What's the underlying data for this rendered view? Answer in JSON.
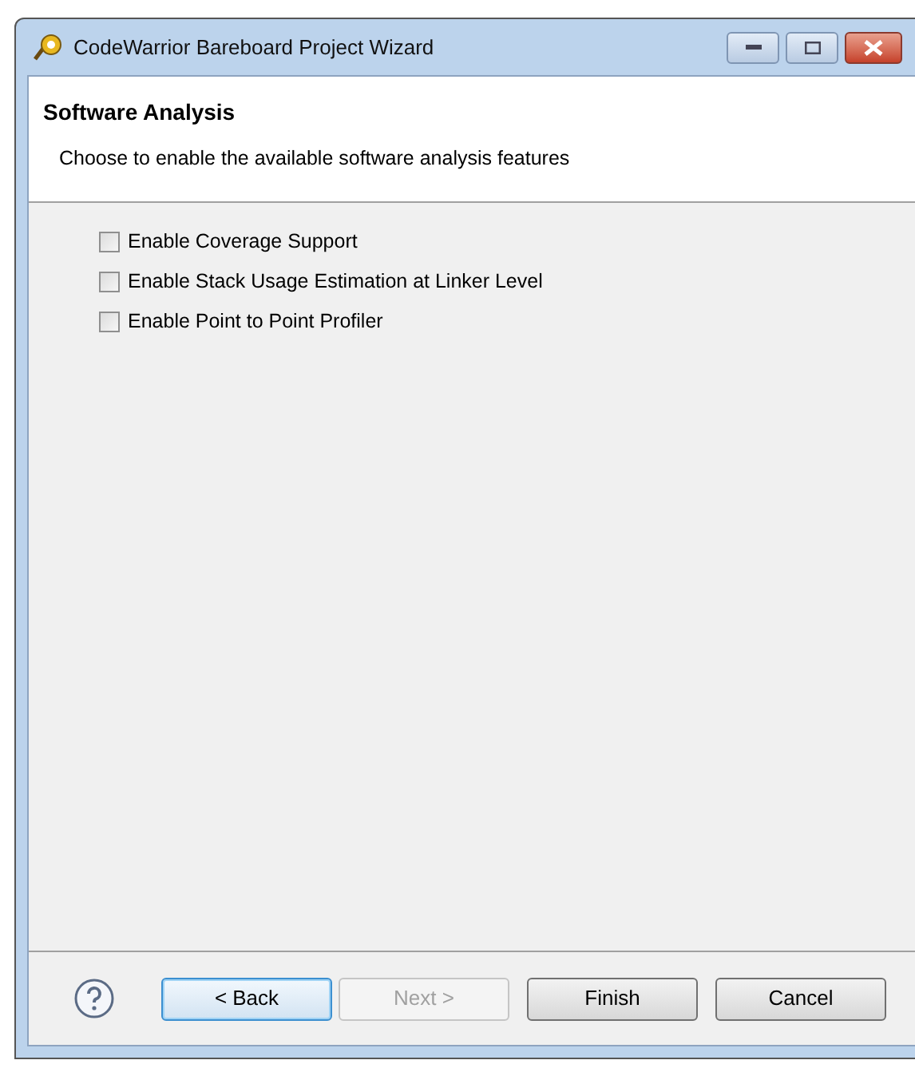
{
  "window": {
    "title": "CodeWarrior Bareboard Project Wizard",
    "controls": [
      {
        "kind": "minimize"
      },
      {
        "kind": "maximize"
      },
      {
        "kind": "close"
      }
    ]
  },
  "header": {
    "title": "Software Analysis",
    "description": "Choose to enable the available software analysis features"
  },
  "options": [
    {
      "label": "Enable Coverage Support",
      "checked": false
    },
    {
      "label": "Enable Stack Usage Estimation at Linker Level",
      "checked": false
    },
    {
      "label": "Enable Point to Point Profiler",
      "checked": false
    }
  ],
  "buttons": [
    {
      "label": "< Back",
      "disabled": false,
      "selected": true
    },
    {
      "label": "Next >",
      "disabled": true,
      "selected": false
    },
    {
      "label": "Finish",
      "disabled": false,
      "selected": false
    },
    {
      "label": "Cancel",
      "disabled": false,
      "selected": false
    }
  ]
}
